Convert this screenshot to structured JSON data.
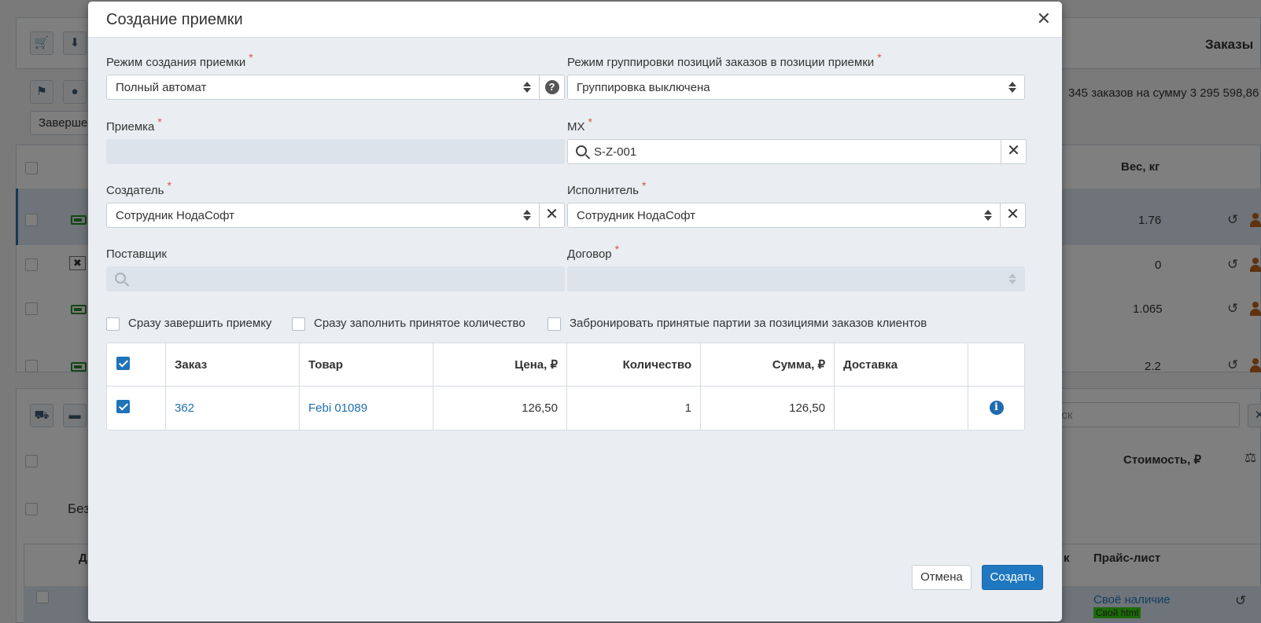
{
  "background": {
    "orders_title": "Заказы",
    "orders_summary": "345 заказов на сумму 3 295 598,86",
    "tab_label": "Заверше",
    "weight_header": "Вес, кг",
    "weights": [
      "1.76",
      "0",
      "1.065",
      "2.2"
    ],
    "cost_header": "Стоимость, ₽",
    "search_placeholder": "иск",
    "group_label": "Без",
    "col_d": "Д",
    "col_k": "к",
    "pricelist_header": "Прайс-лист",
    "pricelist_value": "Своё наличие",
    "pricelist_tag": "Свой html"
  },
  "modal": {
    "title": "Создание приемки",
    "close_icon": "close-icon",
    "mode": {
      "label": "Режим создания приемки",
      "value": "Полный автомат"
    },
    "grouping": {
      "label": "Режим группировки позиций заказов в позиции приемки",
      "value": "Группировка выключена"
    },
    "reception": {
      "label": "Приемка",
      "value": ""
    },
    "location": {
      "label": "МХ",
      "value": "S-Z-001"
    },
    "creator": {
      "label": "Создатель",
      "value": "Сотрудник НодаСофт"
    },
    "executor": {
      "label": "Исполнитель",
      "value": "Сотрудник НодаСофт"
    },
    "supplier": {
      "label": "Поставщик",
      "value": ""
    },
    "contract": {
      "label": "Договор",
      "value": ""
    },
    "options": [
      {
        "label": "Сразу завершить приемку",
        "checked": false
      },
      {
        "label": "Сразу заполнить принятое количество",
        "checked": false
      },
      {
        "label": "Забронировать принятые партии за позициями заказов клиентов",
        "checked": false
      }
    ],
    "table": {
      "headers": [
        "Заказ",
        "Товар",
        "Цена, ₽",
        "Количество",
        "Сумма, ₽",
        "Доставка"
      ],
      "rows": [
        {
          "checked": true,
          "order": "362",
          "product": "Febi 01089",
          "price": "126,50",
          "quantity": "1",
          "sum": "126,50",
          "delivery": ""
        }
      ]
    },
    "cancel_label": "Отмена",
    "create_label": "Создать"
  }
}
